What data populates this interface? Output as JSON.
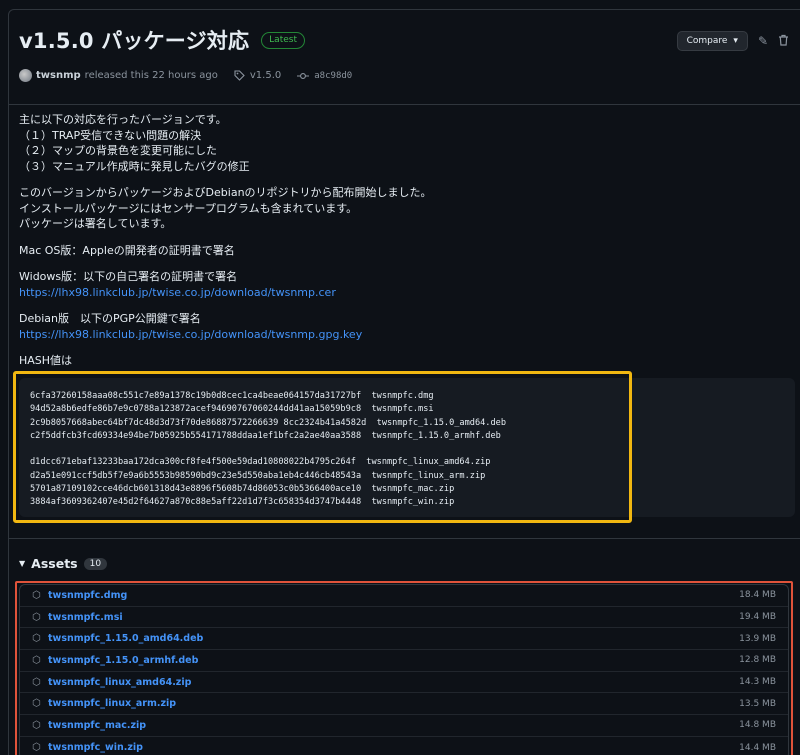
{
  "release": {
    "title": "v1.5.0 パッケージ対応",
    "badge": "Latest",
    "compare_label": "Compare",
    "author": "twsnmp",
    "released_text": "released this 22 hours ago",
    "tag": "v1.5.0",
    "commit": "a8c98d0"
  },
  "body": {
    "intro": "主に以下の対応を行ったバージョンです。",
    "items": [
      "（１）TRAP受信できない問題の解決",
      "（２）マップの背景色を変更可能にした",
      "（３）マニュアル作成時に発見したバグの修正"
    ],
    "para2": [
      "このバージョンからパッケージおよびDebianのリポジトリから配布開始しました。",
      "インストールパッケージにはセンサープログラムも含まれています。",
      "パッケージは署名しています。"
    ],
    "mac": "Mac OS版：Appleの開発者の証明書で署名",
    "windows": "Widows版：以下の自己署名の証明書で署名",
    "windows_link": "https://lhx98.linkclub.jp/twise.co.jp/download/twsnmp.cer",
    "debian": "Debian版　以下のPGP公開鍵で署名",
    "debian_link": "https://lhx98.linkclub.jp/twise.co.jp/download/twsnmp.gpg.key",
    "hash_heading": "HASH値は"
  },
  "hashes": [
    "6cfa37260158aaa08c551c7e89a1378c19b0d8cec1ca4beae064157da31727bf  twsnmpfc.dmg",
    "94d52a8b6edfe86b7e9c0788a123872acef94690767060244dd41aa15059b9c8  twsnmpfc.msi",
    "2c9b8057668abec64bf7dc48d3d73f70de86887572266639 8cc2324b41a4582d  twsnmpfc_1.15.0_amd64.deb",
    "c2f5ddfcb3fcd69334e94be7b05925b554171788ddaa1ef1bfc2a2ae40aa3588  twsnmpfc_1.15.0_armhf.deb",
    "",
    "d1dcc671ebaf13233baa172dca300cf8fe4f500e59dad10808022b4795c264f  twsnmpfc_linux_amd64.zip",
    "d2a51e091ccf5db5f7e9a6b5553b98590bd9c23e5d550aba1eb4c446cb48543a  twsnmpfc_linux_arm.zip",
    "5701a87109102cce46dcb601318d43e8896f5608b74d86053c0b5366400ace10  twsnmpfc_mac.zip",
    "3884af3609362407e45d2f64627a870c88e5aff22d1d7f3c658354d3747b4448  twsnmpfc_win.zip"
  ],
  "assets": {
    "heading": "Assets",
    "count": "10",
    "files": [
      {
        "name": "twsnmpfc.dmg",
        "size": "18.4 MB"
      },
      {
        "name": "twsnmpfc.msi",
        "size": "19.4 MB"
      },
      {
        "name": "twsnmpfc_1.15.0_amd64.deb",
        "size": "13.9 MB"
      },
      {
        "name": "twsnmpfc_1.15.0_armhf.deb",
        "size": "12.8 MB"
      },
      {
        "name": "twsnmpfc_linux_amd64.zip",
        "size": "14.3 MB"
      },
      {
        "name": "twsnmpfc_linux_arm.zip",
        "size": "13.5 MB"
      },
      {
        "name": "twsnmpfc_mac.zip",
        "size": "14.8 MB"
      },
      {
        "name": "twsnmpfc_win.zip",
        "size": "14.4 MB"
      }
    ]
  },
  "icons": {
    "tag": "tag-icon",
    "commit": "commit-icon",
    "edit": "pencil-icon",
    "delete": "trash-icon",
    "package": "package-icon"
  },
  "colors": {
    "background": "#0d1117",
    "link": "#4493f8",
    "latest_badge": "#3fb950",
    "highlight_yellow": "#f1b711",
    "highlight_red": "#e0533a"
  }
}
